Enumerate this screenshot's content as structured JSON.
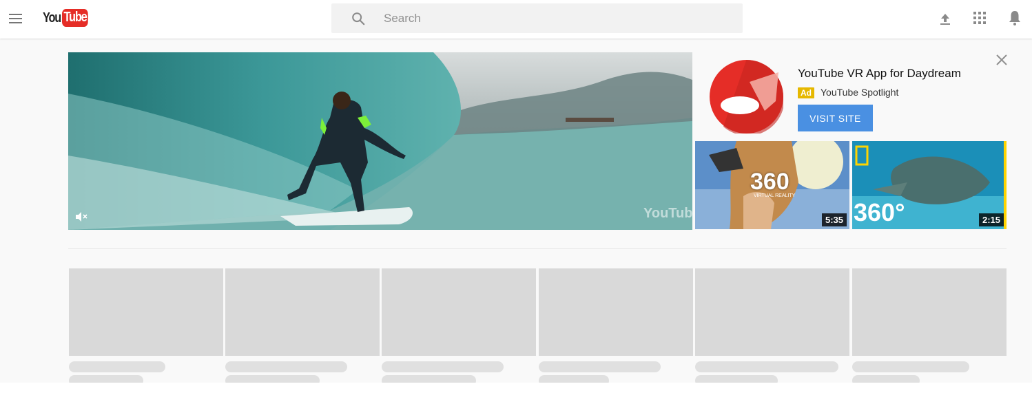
{
  "header": {
    "logo_you": "You",
    "logo_tube": "Tube",
    "search_placeholder": "Search",
    "icons": [
      "menu-icon",
      "search-icon",
      "upload-icon",
      "apps-icon",
      "notifications-icon"
    ]
  },
  "featured": {
    "video_watermark": "YouTube",
    "mute_icon": "volume-off-icon"
  },
  "ad": {
    "title": "YouTube VR App for Daydream",
    "badge": "Ad",
    "channel": "YouTube Spotlight",
    "cta": "VISIT SITE",
    "brand_color": "#e52d27",
    "cta_color": "#4a90e2"
  },
  "thumbnails": [
    {
      "overlay_big": "360",
      "overlay_small": "VIRTUAL REALITY",
      "duration": "5:35"
    },
    {
      "overlay_big": "360°",
      "duration": "2:15"
    }
  ],
  "placeholder_cards": 6
}
